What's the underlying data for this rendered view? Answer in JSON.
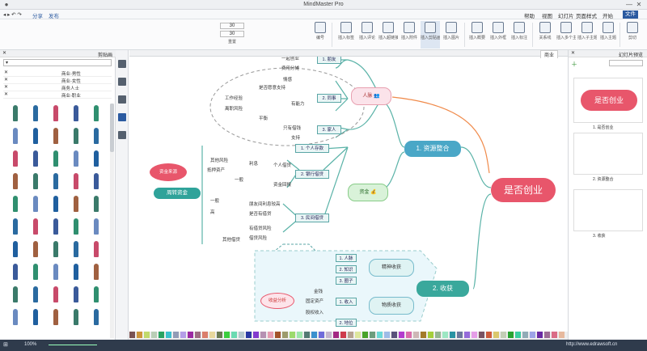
{
  "window": {
    "title": "MindMaster Pro",
    "minimize": "—",
    "maximize": "□",
    "close": "✕"
  },
  "menubar": {
    "items": [
      "文件",
      "开始",
      "页面样式",
      "幻灯片",
      "视图",
      "帮助"
    ],
    "active_index": 0,
    "share": "分享",
    "publish": "发布"
  },
  "ribbon": {
    "groups": [
      {
        "label": "剪切"
      },
      {
        "label": "插入主题"
      },
      {
        "label": "插入子主题"
      },
      {
        "label": "插入多个主题"
      },
      {
        "label": "关系线"
      },
      {
        "label": "插入标注"
      },
      {
        "label": "插入外框"
      },
      {
        "label": "插入概要"
      },
      {
        "label": "插入图片"
      },
      {
        "label": "插入剪贴画"
      },
      {
        "label": "插入附件"
      },
      {
        "label": "插入超链接"
      },
      {
        "label": "插入评论"
      },
      {
        "label": "插入标签"
      },
      {
        "label": "编号"
      },
      {
        "label": "重置"
      }
    ],
    "font_size_1": "30",
    "font_size_2": "30"
  },
  "left_panel": {
    "title": "剪贴画",
    "search_placeholder": "",
    "categories": [
      "商业-男性",
      "商业-女性",
      "商务人士",
      "商业-职业"
    ]
  },
  "tabs": {
    "current": "商业"
  },
  "mindmap": {
    "central": "是否创业",
    "branches": {
      "b1": "1. 资源整合",
      "b2": "2. 收获"
    },
    "b1_children": {
      "people": "人脉",
      "money": "资金",
      "p1": "1. 朋友",
      "p2": "2. 同事",
      "p3": "3. 家人",
      "p1a": "一起创业",
      "p1b": "费用分摊",
      "p2a": "情感",
      "p2b": "是否愿意支持",
      "p2c": "有能力",
      "p2d": "离职风险",
      "p2e": "资历",
      "p2f": "工作经验",
      "p2g": "是否可靠",
      "p2h": "平衡",
      "p3a": "只有借钱",
      "p3b": "支持",
      "m1": "1. 个人存款",
      "m2": "2. 银行借贷",
      "m3": "3. 民间借贷",
      "m2a": "个人借贷",
      "m2b": "资金回报",
      "m2c": "利息",
      "m2d": "其他风险",
      "m2e": "一般",
      "m2f": "抵押资产",
      "m3a": "朋友间利息较高",
      "m3b": "一般",
      "m3c": "高",
      "m3d": "有借贷风险",
      "m3e": "是否有借贷",
      "m3f": "借贷风险",
      "m3g": "其他借贷",
      "cloud1": "资金来源",
      "cloud1b": "周转资金"
    },
    "b2_children": {
      "spirit": "精神收获",
      "material": "物质收获",
      "s1": "1. 人脉",
      "s2": "2. 知识",
      "s3": "3. 圈子",
      "mt1": "1. 收入",
      "mt2": "2. 地位",
      "mt1a": "金钱",
      "mt1b": "固定资产",
      "mt1c": "股权收入",
      "cloud2": "收益分析"
    }
  },
  "right_panel": {
    "title": "幻灯片预览",
    "slides": [
      "1. 是否创业",
      "2. 资源整合",
      "3. 收获"
    ],
    "slide1_title": "是否创业"
  },
  "status": {
    "zoom": "100%",
    "link": "http://www.edrawsoft.cn"
  },
  "colors": {
    "central": "#e8566b",
    "branch": "#4aa7c7",
    "teal": "#3aa89c",
    "green_accent": "#2a8c2a"
  }
}
